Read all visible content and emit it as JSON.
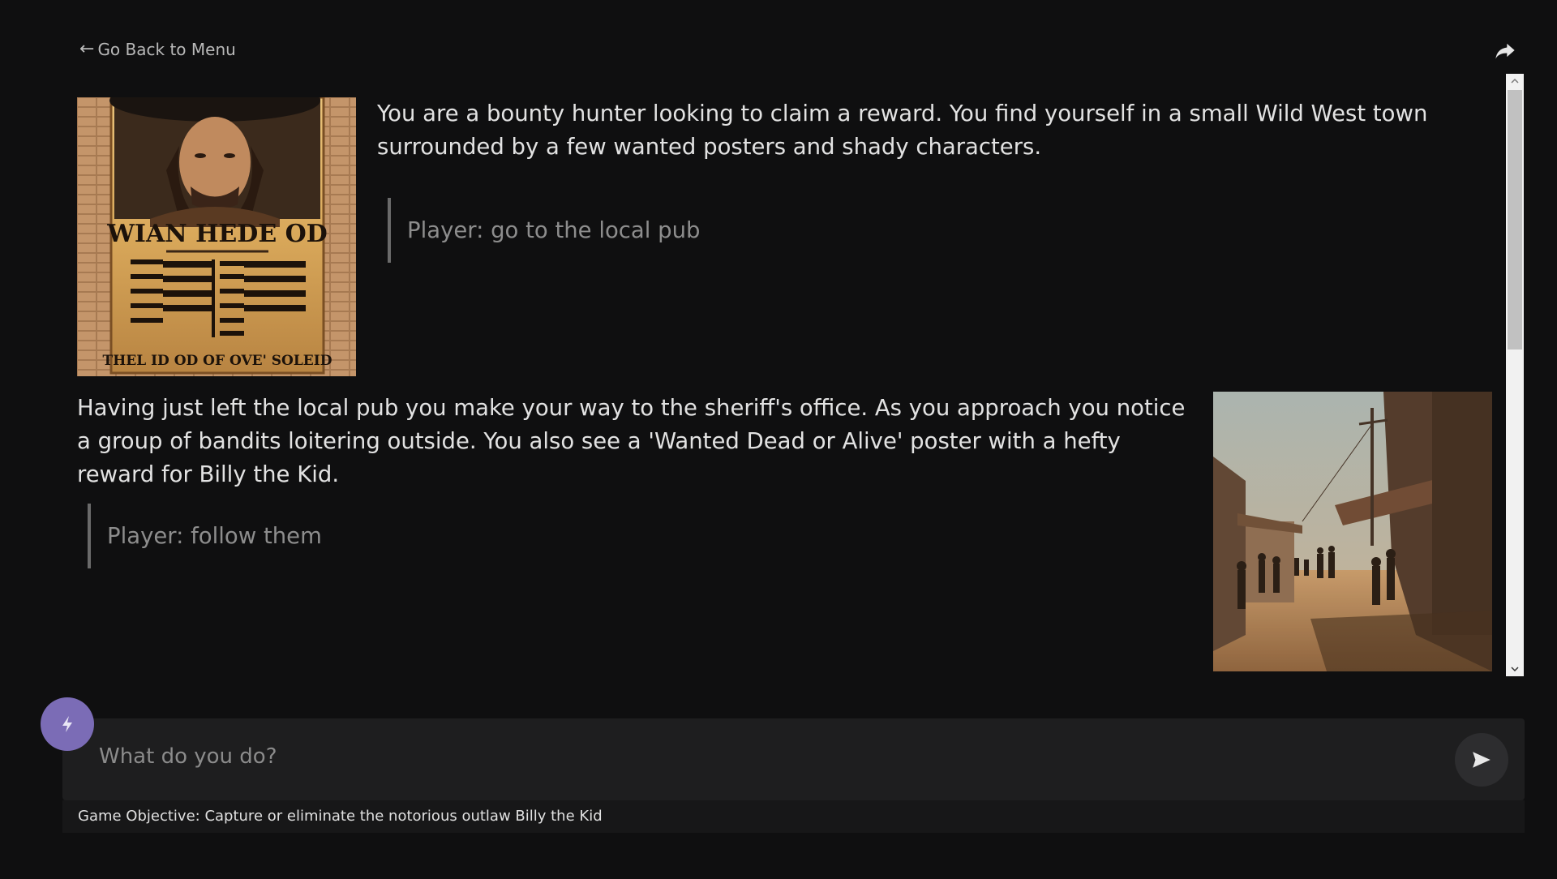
{
  "nav": {
    "back_arrow": "←",
    "back_label": "Go Back to Menu"
  },
  "story": {
    "turns": [
      {
        "narration": "You are a bounty hunter looking to claim a reward. You find yourself in a small Wild West town surrounded by a few wanted posters and shady characters.",
        "player": "Player: go to the local pub",
        "image": {
          "poster_title": "WIAN HEDE OD",
          "poster_footer": "THEL ID OD OF OVE' SOLEID"
        }
      },
      {
        "narration": "Having just left the local pub you make your way to the sheriff's office. As you approach you notice a group of bandits loitering outside. You also see a 'Wanted Dead or Alive' poster with a hefty reward for Billy the Kid.",
        "player": "Player: follow them"
      }
    ]
  },
  "input": {
    "placeholder": "What do you do?"
  },
  "objective": {
    "text": "Game Objective: Capture or eliminate the notorious outlaw Billy the Kid"
  },
  "colors": {
    "background": "#0f0f10",
    "accent": "#7b6cb6",
    "input_bg": "#1e1e1f"
  },
  "icons": {
    "share": "share-arrow-icon",
    "magic": "lightning-icon",
    "send": "send-icon"
  }
}
